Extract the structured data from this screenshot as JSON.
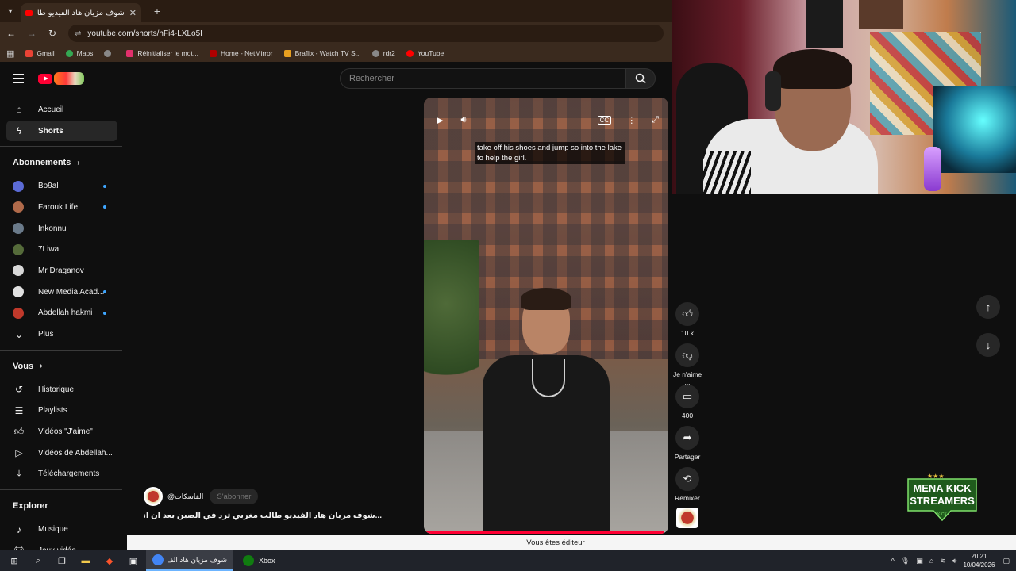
{
  "browser": {
    "tab": {
      "title": "شوف مزيان هاد الفيديو طالب مغ"
    },
    "url": "youtube.com/shorts/hFi4-LXLo5I",
    "bookmarks": [
      {
        "label": "Gmail",
        "color": "#ea4335"
      },
      {
        "label": "Maps",
        "color": "#34a853"
      },
      {
        "label": "",
        "color": "#888888"
      },
      {
        "label": "Réinitialiser le mot...",
        "color": "#e1306c"
      },
      {
        "label": "Home - NetMirror",
        "color": "#b00000"
      },
      {
        "label": "Braflix - Watch TV S...",
        "color": "#e8a020"
      },
      {
        "label": "rdr2",
        "color": "#888888"
      },
      {
        "label": "YouTube",
        "color": "#ff0000"
      }
    ]
  },
  "youtube": {
    "search_placeholder": "Rechercher",
    "sidebar": {
      "main": [
        {
          "label": "Accueil",
          "icon": "home-icon"
        },
        {
          "label": "Shorts",
          "icon": "shorts-icon",
          "active": true
        }
      ],
      "subscriptions_title": "Abonnements",
      "subscriptions": [
        {
          "label": "Bo9al",
          "color": "#5b6bd6",
          "dot": true
        },
        {
          "label": "Farouk Life",
          "color": "#b06a4a",
          "dot": true
        },
        {
          "label": "Inkonnu",
          "color": "#6a7a8a",
          "dot": false
        },
        {
          "label": "7Liwa",
          "color": "#556b3a",
          "dot": false
        },
        {
          "label": "Mr Draganov",
          "color": "#d8d8d8",
          "dot": false
        },
        {
          "label": "New Media Acad...",
          "color": "#e0e0e0",
          "dot": true
        },
        {
          "label": "Abdellah hakmi",
          "color": "#c0392b",
          "dot": true
        },
        {
          "label": "Plus",
          "color": "",
          "dot": false
        }
      ],
      "you_title": "Vous",
      "you": [
        {
          "label": "Historique",
          "icon": "history-icon"
        },
        {
          "label": "Playlists",
          "icon": "playlists-icon"
        },
        {
          "label": "Vidéos \"J'aime\"",
          "icon": "like-icon"
        },
        {
          "label": "Vidéos de Abdellah...",
          "icon": "your-videos-icon"
        },
        {
          "label": "Téléchargements",
          "icon": "download-icon"
        }
      ],
      "explore_title": "Explorer",
      "explore": [
        {
          "label": "Musique",
          "icon": "music-icon"
        },
        {
          "label": "Jeux vidéo",
          "icon": "gaming-icon"
        }
      ]
    },
    "short": {
      "caption": "take off his shoes and jump so into the lake to help the girl.",
      "channel": "@الفاسكات",
      "subscribe_label": "S'abonner",
      "title": "...شوف مزيان هاد الفيديو طالب مغربي ترد في الصين بعد ان انقد فتاة",
      "progress": 0.98,
      "actions": {
        "likes": "10 k",
        "dislike": "Je n'aime ...",
        "comments": "400",
        "share": "Partager",
        "remix": "Remixer"
      }
    },
    "editor_notice": "Vous êtes éditeur"
  },
  "badge": {
    "line1": "MENA KICK",
    "line2": "STREAMERS",
    "line3": "KICK"
  },
  "taskbar": {
    "apps": [
      {
        "label": "شوف مزيان هاد الف",
        "active": true,
        "color": "#4285f4"
      },
      {
        "label": "Xbox",
        "active": false,
        "color": "#107c10"
      }
    ],
    "time": "20:21",
    "date": "10/04/2026"
  }
}
